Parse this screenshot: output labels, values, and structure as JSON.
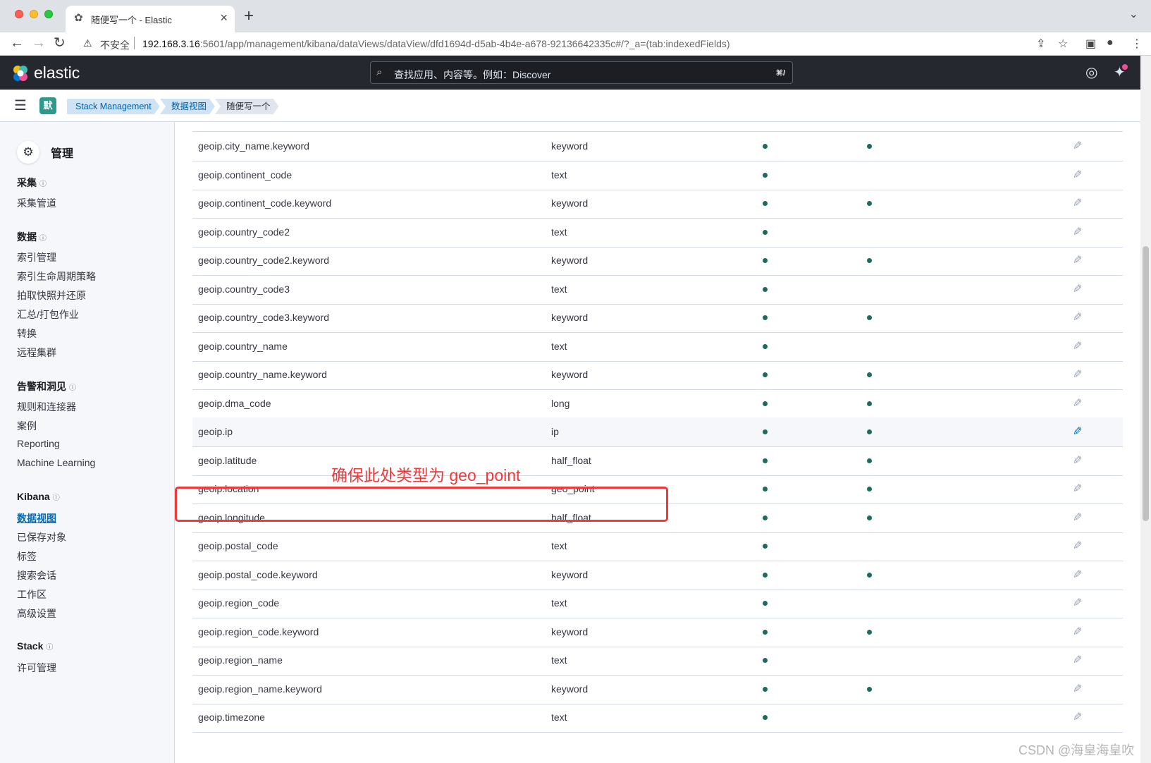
{
  "browser": {
    "tab_title": "随便写一个 - Elastic",
    "tab_close": "×",
    "new_tab": "+",
    "tab_menu": "⌄",
    "insecure_label": "不安全",
    "url_host": "192.168.3.16",
    "url_rest": ":5601/app/management/kibana/dataViews/dataView/dfd1694d-d5ab-4b4e-a678-92136642335c#/?_a=(tab:indexedFields)"
  },
  "header": {
    "brand": "elastic",
    "search_placeholder": "查找应用、内容等。例如：Discover",
    "search_shortcut": "⌘/"
  },
  "breadcrumbs": {
    "space_initial": "默",
    "items": [
      "Stack Management",
      "数据视图",
      "随便写一个"
    ]
  },
  "sidebar": {
    "title": "管理",
    "groups": [
      {
        "label": "采集",
        "items": [
          "采集管道"
        ]
      },
      {
        "label": "数据",
        "items": [
          "索引管理",
          "索引生命周期策略",
          "拍取快照并还原",
          "汇总/打包作业",
          "转换",
          "远程集群"
        ]
      },
      {
        "label": "告警和洞见",
        "items": [
          "规则和连接器",
          "案例",
          "Reporting",
          "Machine Learning"
        ]
      },
      {
        "label": "Kibana",
        "items": [
          "数据视图",
          "已保存对象",
          "标签",
          "搜索会话",
          "工作区",
          "高级设置"
        ]
      },
      {
        "label": "Stack",
        "items": [
          "许可管理"
        ]
      }
    ],
    "active_item": "数据视图"
  },
  "fields": [
    {
      "name": "geoip.city_name.keyword",
      "type": "keyword",
      "searchable": true,
      "aggregatable": true
    },
    {
      "name": "geoip.continent_code",
      "type": "text",
      "searchable": true,
      "aggregatable": false
    },
    {
      "name": "geoip.continent_code.keyword",
      "type": "keyword",
      "searchable": true,
      "aggregatable": true
    },
    {
      "name": "geoip.country_code2",
      "type": "text",
      "searchable": true,
      "aggregatable": false
    },
    {
      "name": "geoip.country_code2.keyword",
      "type": "keyword",
      "searchable": true,
      "aggregatable": true
    },
    {
      "name": "geoip.country_code3",
      "type": "text",
      "searchable": true,
      "aggregatable": false
    },
    {
      "name": "geoip.country_code3.keyword",
      "type": "keyword",
      "searchable": true,
      "aggregatable": true
    },
    {
      "name": "geoip.country_name",
      "type": "text",
      "searchable": true,
      "aggregatable": false
    },
    {
      "name": "geoip.country_name.keyword",
      "type": "keyword",
      "searchable": true,
      "aggregatable": true
    },
    {
      "name": "geoip.dma_code",
      "type": "long",
      "searchable": true,
      "aggregatable": true
    },
    {
      "name": "geoip.ip",
      "type": "ip",
      "searchable": true,
      "aggregatable": true,
      "hover": true
    },
    {
      "name": "geoip.latitude",
      "type": "half_float",
      "searchable": true,
      "aggregatable": true
    },
    {
      "name": "geoip.location",
      "type": "geo_point",
      "searchable": true,
      "aggregatable": true
    },
    {
      "name": "geoip.longitude",
      "type": "half_float",
      "searchable": true,
      "aggregatable": true
    },
    {
      "name": "geoip.postal_code",
      "type": "text",
      "searchable": true,
      "aggregatable": false
    },
    {
      "name": "geoip.postal_code.keyword",
      "type": "keyword",
      "searchable": true,
      "aggregatable": true
    },
    {
      "name": "geoip.region_code",
      "type": "text",
      "searchable": true,
      "aggregatable": false
    },
    {
      "name": "geoip.region_code.keyword",
      "type": "keyword",
      "searchable": true,
      "aggregatable": true
    },
    {
      "name": "geoip.region_name",
      "type": "text",
      "searchable": true,
      "aggregatable": false
    },
    {
      "name": "geoip.region_name.keyword",
      "type": "keyword",
      "searchable": true,
      "aggregatable": true
    },
    {
      "name": "geoip.timezone",
      "type": "text",
      "searchable": true,
      "aggregatable": false
    }
  ],
  "annotation": "确保此处类型为 geo_point",
  "watermark": "CSDN @海皇海皇吹",
  "colors": {
    "accent": "#006bb8",
    "dot": "#1e6b5d",
    "annotation": "#f03a3a",
    "header": "#25282f"
  }
}
